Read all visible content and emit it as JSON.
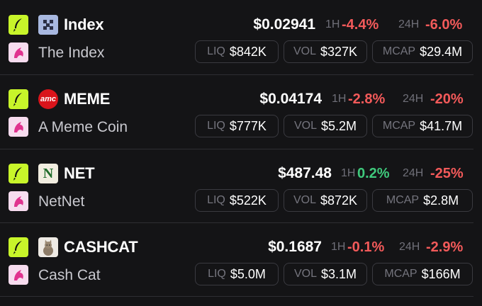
{
  "tokens": [
    {
      "ticker": "Index",
      "name": "The Index",
      "price": "$0.02941",
      "h1_label": "1H",
      "h1_change": "-4.4%",
      "h24_label": "24H",
      "h24_change": "-6.0%",
      "liq_label": "LIQ",
      "liq": "$842K",
      "vol_label": "VOL",
      "vol": "$327K",
      "mcap_label": "MCAP",
      "mcap": "$29.4M",
      "logo_icon": "index-grid-logo-icon"
    },
    {
      "ticker": "MEME",
      "name": "A Meme Coin",
      "price": "$0.04174",
      "h1_label": "1H",
      "h1_change": "-2.8%",
      "h24_label": "24H",
      "h24_change": "-20%",
      "liq_label": "LIQ",
      "liq": "$777K",
      "vol_label": "VOL",
      "vol": "$5.2M",
      "mcap_label": "MCAP",
      "mcap": "$41.7M",
      "logo_icon": "amc-logo-icon",
      "logo_text": "amc"
    },
    {
      "ticker": "NET",
      "name": "NetNet",
      "price": "$487.48",
      "h1_label": "1H",
      "h1_change": "0.2%",
      "h24_label": "24H",
      "h24_change": "-25%",
      "liq_label": "LIQ",
      "liq": "$522K",
      "vol_label": "VOL",
      "vol": "$872K",
      "mcap_label": "MCAP",
      "mcap": "$2.8M",
      "logo_icon": "netnet-n-logo-icon",
      "logo_text": "N"
    },
    {
      "ticker": "CASHCAT",
      "name": "Cash Cat",
      "price": "$0.1687",
      "h1_label": "1H",
      "h1_change": "-0.1%",
      "h24_label": "24H",
      "h24_change": "-2.9%",
      "liq_label": "LIQ",
      "liq": "$5.0M",
      "vol_label": "VOL",
      "vol": "$3.1M",
      "mcap_label": "MCAP",
      "mcap": "$166M",
      "logo_icon": "cat-logo-icon"
    }
  ],
  "icons": {
    "platform_badge": "quill-icon",
    "dex_badge": "uniswap-unicorn-icon"
  },
  "colors": {
    "background": "#141416",
    "negative": "#f35a5a",
    "positive": "#3fc97c",
    "platform_badge": "#c8f52a",
    "dex_badge": "#f7dcef"
  }
}
